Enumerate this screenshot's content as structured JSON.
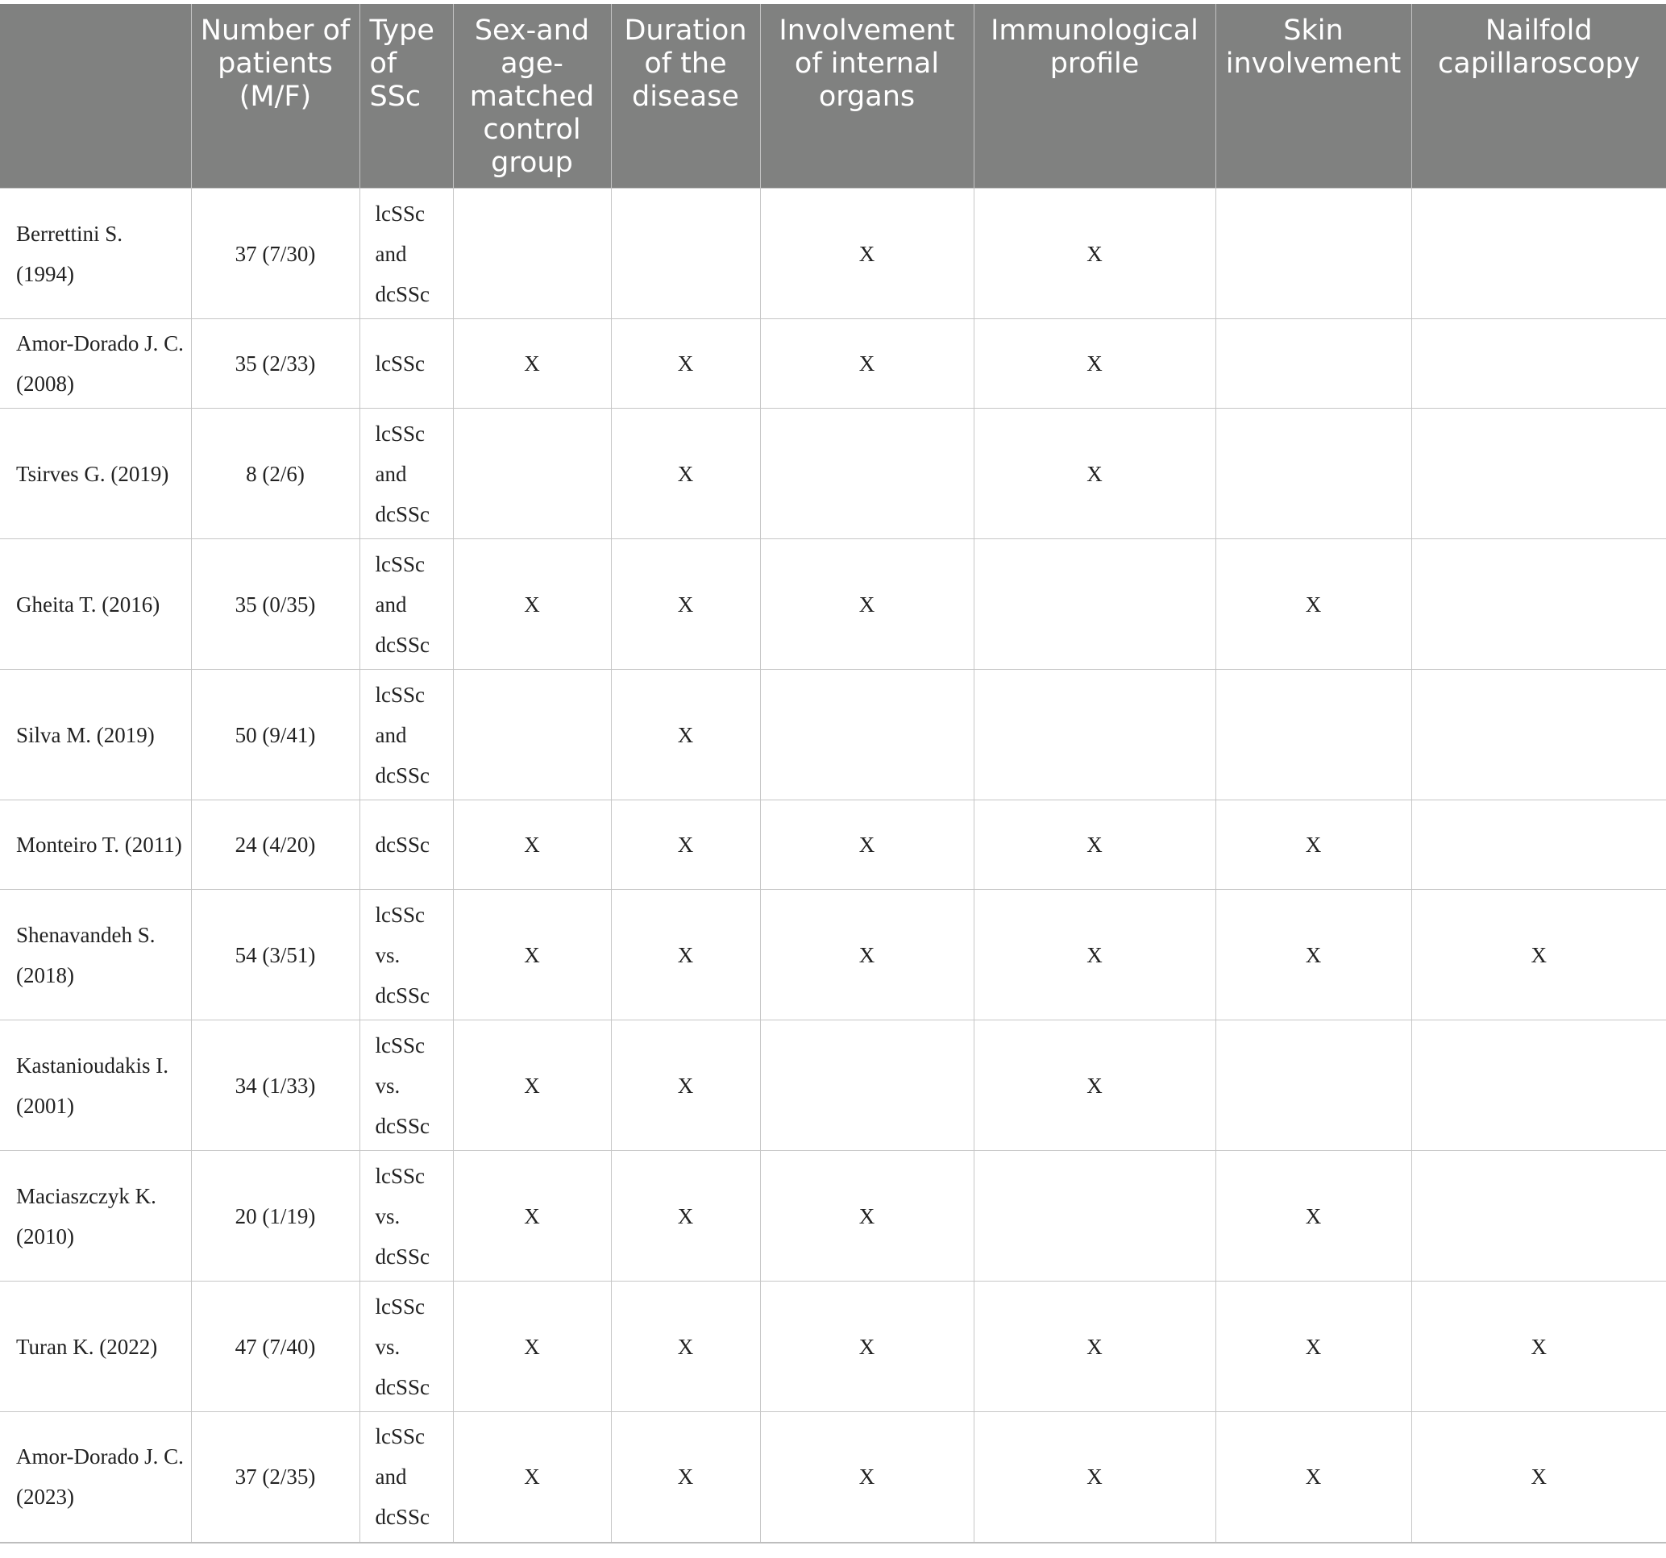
{
  "table": {
    "headers": [
      "",
      "Number of patients (M/F)",
      "Type of SSc",
      "Sex-and age-matched control group",
      "Duration of the disease",
      "Involvement of internal organs",
      "Immunological profile",
      "Skin involvement",
      "Nailfold capillaroscopy"
    ],
    "rows": [
      {
        "study": "Berrettini S. (1994)",
        "patients": "37 (7/30)",
        "type": "lcSSc and dcSSc",
        "control": "",
        "duration": "",
        "organs": "X",
        "immuno": "X",
        "skin": "",
        "nailfold": ""
      },
      {
        "study": "Amor-Dorado J. C. (2008)",
        "patients": "35 (2/33)",
        "type": "lcSSc",
        "control": "X",
        "duration": "X",
        "organs": "X",
        "immuno": "X",
        "skin": "",
        "nailfold": ""
      },
      {
        "study": "Tsirves G. (2019)",
        "patients": "8 (2/6)",
        "type": "lcSSc and dcSSc",
        "control": "",
        "duration": "X",
        "organs": "",
        "immuno": "X",
        "skin": "",
        "nailfold": ""
      },
      {
        "study": "Gheita T. (2016)",
        "patients": "35 (0/35)",
        "type": "lcSSc and dcSSc",
        "control": "X",
        "duration": "X",
        "organs": "X",
        "immuno": "",
        "skin": "X",
        "nailfold": ""
      },
      {
        "study": "Silva M. (2019)",
        "patients": "50 (9/41)",
        "type": "lcSSc and dcSSc",
        "control": "",
        "duration": "X",
        "organs": "",
        "immuno": "",
        "skin": "",
        "nailfold": ""
      },
      {
        "study": "Monteiro T. (2011)",
        "patients": "24 (4/20)",
        "type": "dcSSc",
        "control": "X",
        "duration": "X",
        "organs": "X",
        "immuno": "X",
        "skin": "X",
        "nailfold": ""
      },
      {
        "study": "Shenavandeh S. (2018)",
        "patients": "54 (3/51)",
        "type": "lcSSc vs. dcSSc",
        "control": "X",
        "duration": "X",
        "organs": "X",
        "immuno": "X",
        "skin": "X",
        "nailfold": "X"
      },
      {
        "study": "Kastanioudakis I. (2001)",
        "patients": "34 (1/33)",
        "type": "lcSSc vs. dcSSc",
        "control": "X",
        "duration": "X",
        "organs": "",
        "immuno": "X",
        "skin": "",
        "nailfold": ""
      },
      {
        "study": "Maciaszczyk K. (2010)",
        "patients": "20 (1/19)",
        "type": "lcSSc vs. dcSSc",
        "control": "X",
        "duration": "X",
        "organs": "X",
        "immuno": "",
        "skin": "X",
        "nailfold": ""
      },
      {
        "study": "Turan K. (2022)",
        "patients": "47 (7/40)",
        "type": "lcSSc vs. dcSSc",
        "control": "X",
        "duration": "X",
        "organs": "X",
        "immuno": "X",
        "skin": "X",
        "nailfold": "X"
      },
      {
        "study": "Amor-Dorado J. C. (2023)",
        "patients": "37 (2/35)",
        "type": "lcSSc and dcSSc",
        "control": "X",
        "duration": "X",
        "organs": "X",
        "immuno": "X",
        "skin": "X",
        "nailfold": "X"
      }
    ]
  }
}
